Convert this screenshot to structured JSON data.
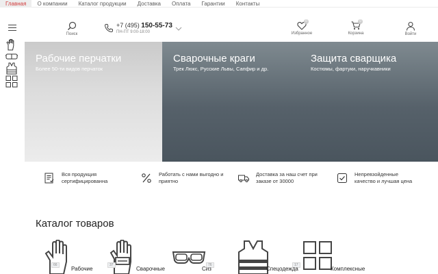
{
  "topnav": {
    "items": [
      {
        "label": "Главная",
        "active": true
      },
      {
        "label": "О компании"
      },
      {
        "label": "Каталог продукции"
      },
      {
        "label": "Доставка"
      },
      {
        "label": "Оплата"
      },
      {
        "label": "Гарантии"
      },
      {
        "label": "Контакты"
      }
    ]
  },
  "header": {
    "search_label": "Поиск",
    "phone_prefix": "+7 (495)",
    "phone_main": "150-55-73",
    "phone_hours": "ПН-ПТ 9:00-18:00",
    "favorites_label": "Избранное",
    "favorites_count": "0",
    "cart_label": "Корзина",
    "cart_count": "0",
    "login_label": "Войти"
  },
  "banners": [
    {
      "title": "Рабочие перчатки",
      "subtitle": "Более 50-ти видов перчаток"
    },
    {
      "title": "Сварочные краги",
      "subtitle": "Трек Люкс, Русские Львы, Сапфир и др."
    },
    {
      "title": "Защита сварщика",
      "subtitle": "Костюмы, фартуки, наручкавники"
    }
  ],
  "features": [
    {
      "icon": "certificate-icon",
      "text": "Вся продукция сертифицированна"
    },
    {
      "icon": "percent-icon",
      "text": "Работать с нами выгодно и приятно"
    },
    {
      "icon": "truck-icon",
      "text": "Доставка за наш счет при заказе от 30000"
    },
    {
      "icon": "check-icon",
      "text": "Непревзойденные качество и лучшая цена"
    }
  ],
  "catalog": {
    "title": "Каталог товаров",
    "items": [
      {
        "label": "Рабочие",
        "count": "66",
        "icon": "glove-icon"
      },
      {
        "label": "Сварочные",
        "count": "37",
        "icon": "welding-glove-icon"
      },
      {
        "label": "Сиз",
        "count": "76",
        "icon": "goggles-icon"
      },
      {
        "label": "Спецодежда",
        "count": "17",
        "icon": "vest-icon"
      },
      {
        "label": "Комплексные",
        "count": "",
        "icon": "grid-icon"
      }
    ]
  },
  "colors": {
    "active_nav": "#d13b3b",
    "banner_dark": "#4a555e",
    "banner_light": "#d6d6d6"
  }
}
